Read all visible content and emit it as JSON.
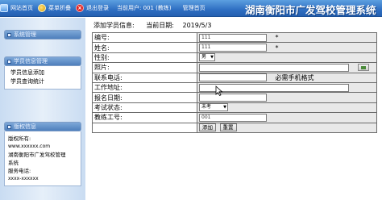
{
  "topnav": {
    "items": [
      {
        "icon": "home-icon",
        "label": "网站首页"
      },
      {
        "icon": "menu-icon",
        "label": "菜单折叠"
      },
      {
        "icon": "exit-icon",
        "label": "退出登录"
      }
    ],
    "current_user": "当前用户: 001 (教练)",
    "mgmt_link": "管理首页",
    "site_title": "湖南衡阳市广发驾校管理系统"
  },
  "sidebar": {
    "panels": [
      {
        "title": "系统管理",
        "items": []
      },
      {
        "title": "学员信息管理",
        "items": [
          "学员信息添加",
          "学员查询统计"
        ]
      },
      {
        "title": "版权信息",
        "items": []
      }
    ],
    "copyright": {
      "owner_label": "版权所有:",
      "website": "www.xxxxxx.com",
      "owner_name_1": "湖南衡阳市广发驾校管理",
      "owner_name_2": "系统",
      "service_label": "服务电话:",
      "service_phone": "xxxx-xxxxxx"
    }
  },
  "main": {
    "heading": "添加学员信息:",
    "date_label": "当前日期:",
    "date_value": "2019/5/3",
    "fields": {
      "number": {
        "label": "编号:",
        "value": "111",
        "required": "*"
      },
      "name": {
        "label": "姓名:",
        "value": "111",
        "required": "*"
      },
      "gender": {
        "label": "性别:",
        "selected": "男"
      },
      "photo": {
        "label": "照片:"
      },
      "phone": {
        "label": "联系电话:",
        "hint": "必需手机格式"
      },
      "address": {
        "label": "工作地址:"
      },
      "signup_date": {
        "label": "报名日期:"
      },
      "exam_status": {
        "label": "考试状态:",
        "selected": "未考"
      },
      "coach_id": {
        "label": "教练工号:",
        "value": "001"
      }
    },
    "buttons": {
      "add": "添加",
      "reset": "重置"
    }
  }
}
